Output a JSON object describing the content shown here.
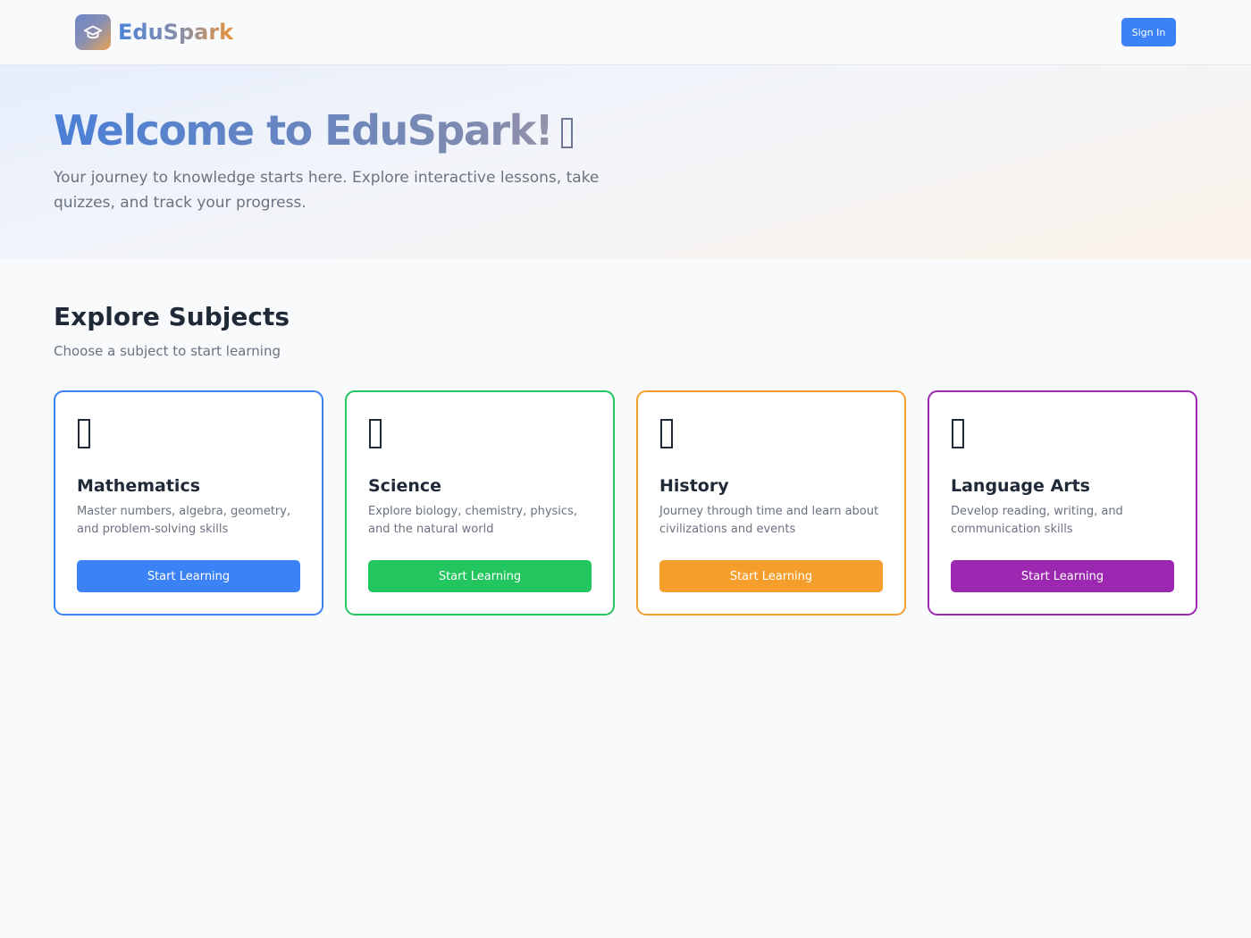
{
  "header": {
    "brand": "EduSpark",
    "logo_icon": "graduation-cap-icon",
    "signin_label": "Sign In"
  },
  "hero": {
    "title": "Welcome to EduSpark!",
    "subtitle": "Your journey to knowledge starts here. Explore interactive lessons, take quizzes, and track your progress."
  },
  "subjects": {
    "title": "Explore Subjects",
    "subtitle": "Choose a subject to start learning",
    "cards": [
      {
        "title": "Mathematics",
        "description": "Master numbers, algebra, geometry, and problem-solving skills",
        "button": "Start Learning",
        "color": "#3b82f6"
      },
      {
        "title": "Science",
        "description": "Explore biology, chemistry, physics, and the natural world",
        "button": "Start Learning",
        "color": "#22c55e"
      },
      {
        "title": "History",
        "description": "Journey through time and learn about civilizations and events",
        "button": "Start Learning",
        "color": "#f59e2b"
      },
      {
        "title": "Language Arts",
        "description": "Develop reading, writing, and communication skills",
        "button": "Start Learning",
        "color": "#9c27b0"
      }
    ]
  },
  "colors": {
    "primary": "#3b82f6",
    "background": "#f8fafc"
  }
}
